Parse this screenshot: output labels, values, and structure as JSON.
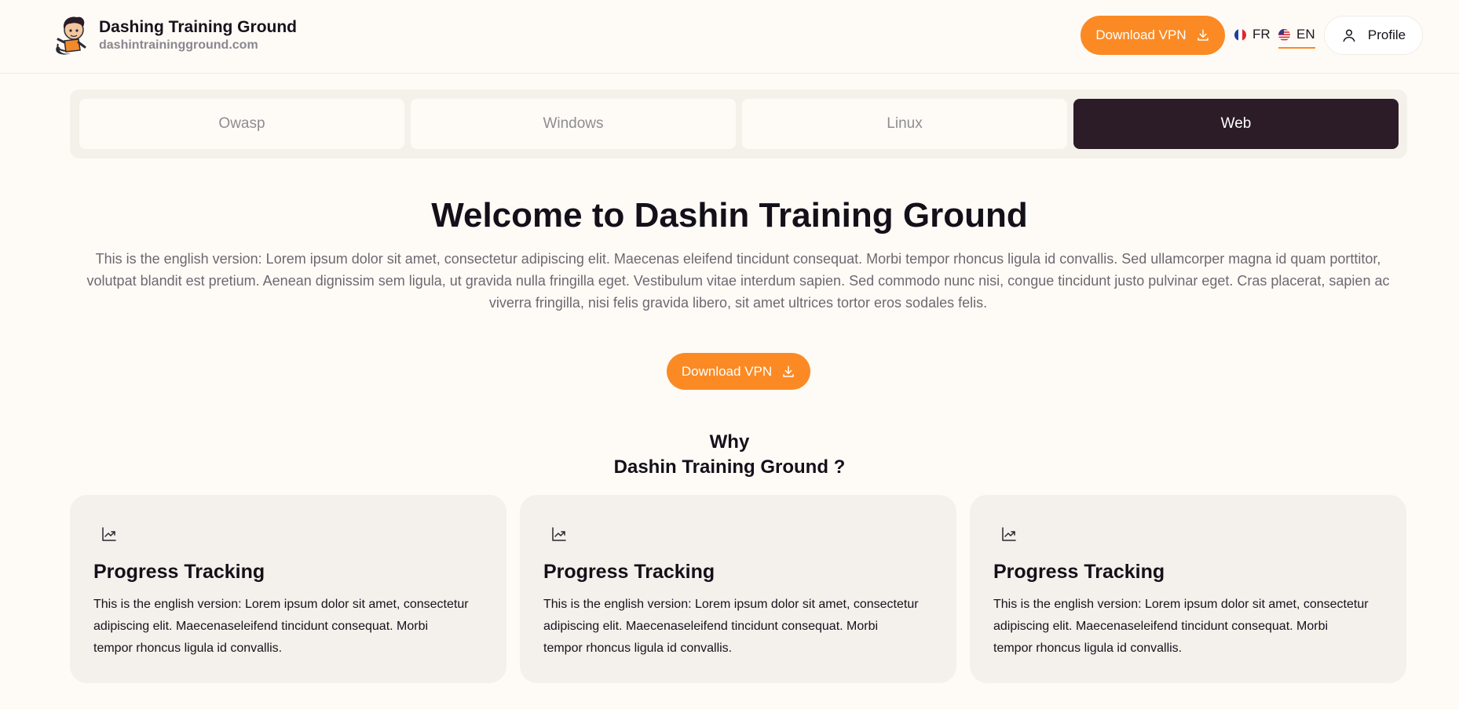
{
  "brand": {
    "title": "Dashing Training Ground",
    "url": "dashintrainingground.com"
  },
  "header": {
    "download_label": "Download VPN",
    "languages": [
      {
        "code": "FR",
        "flag": "france-flag-icon",
        "active": false
      },
      {
        "code": "EN",
        "flag": "us-flag-icon",
        "active": true
      }
    ],
    "profile_label": "Profile"
  },
  "tabs": [
    {
      "label": "Owasp",
      "active": false
    },
    {
      "label": "Windows",
      "active": false
    },
    {
      "label": "Linux",
      "active": false
    },
    {
      "label": "Web",
      "active": true
    }
  ],
  "hero": {
    "title": "Welcome to Dashin Training Ground",
    "text": "This is the english version: Lorem ipsum dolor sit amet, consectetur adipiscing elit. Maecenas eleifend tincidunt consequat. Morbi tempor rhoncus ligula id convallis. Sed ullamcorper magna id quam porttitor, volutpat blandit est pretium. Aenean dignissim sem ligula, ut gravida nulla fringilla eget. Vestibulum vitae interdum sapien. Sed commodo nunc nisi, congue tincidunt justo pulvinar eget. Cras placerat, sapien ac viverra fringilla, nisi felis gravida libero, sit amet ultrices tortor eros sodales felis.",
    "download_label": "Download VPN"
  },
  "why": {
    "line1": "Why",
    "line2": "Dashin Training Ground ?"
  },
  "cards": [
    {
      "icon": "trending-up-icon",
      "title": "Progress Tracking",
      "text": "This is the english version: Lorem ipsum dolor sit amet, consectetur adipiscing elit. Maecenaseleifend tincidunt consequat. Morbi tempor rhoncus ligula id convallis."
    },
    {
      "icon": "trending-up-icon",
      "title": "Progress Tracking",
      "text": "This is the english version: Lorem ipsum dolor sit amet, consectetur adipiscing elit. Maecenaseleifend tincidunt consequat. Morbi tempor rhoncus ligula id convallis."
    },
    {
      "icon": "trending-up-icon",
      "title": "Progress Tracking",
      "text": "This is the english version: Lorem ipsum dolor sit amet, consectetur adipiscing elit. Maecenaseleifend tincidunt consequat. Morbi tempor rhoncus ligula id convallis."
    }
  ],
  "colors": {
    "accent": "#fb8a24",
    "active_tab": "#2b1c27",
    "background": "#fefbf6",
    "card_bg": "#f4f0eb"
  }
}
